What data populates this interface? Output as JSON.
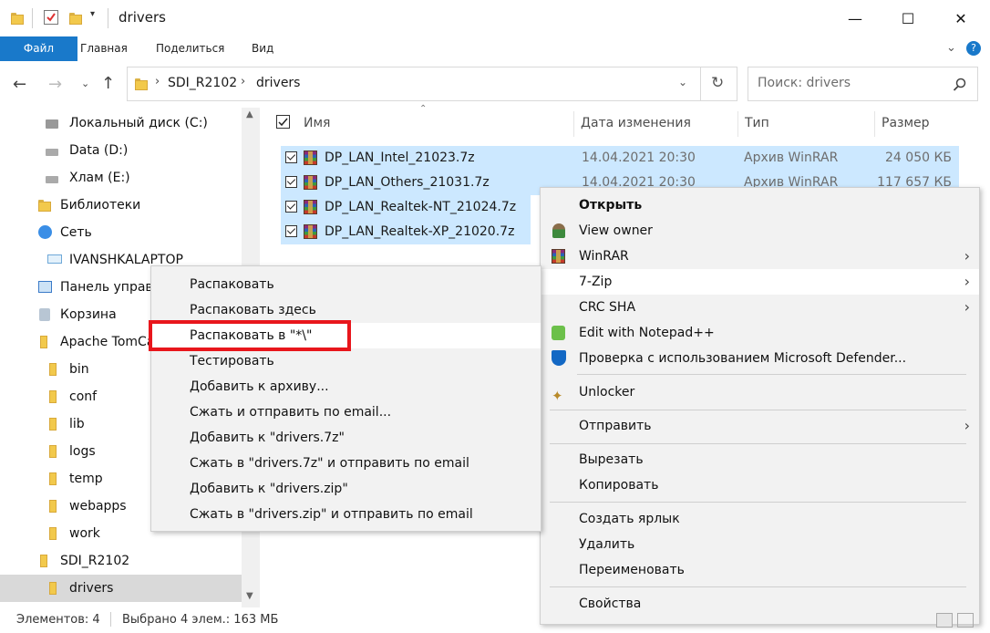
{
  "window": {
    "title": "drivers",
    "minimize": "—",
    "maximize": "☐",
    "close": "✕"
  },
  "ribbon": {
    "tabs": [
      "Файл",
      "Главная",
      "Поделиться",
      "Вид"
    ]
  },
  "address": {
    "crumbs": [
      "SDI_R2102",
      "drivers"
    ]
  },
  "search": {
    "placeholder": "Поиск: drivers"
  },
  "nav": {
    "items": [
      "Локальный диск (C:)",
      "Data (D:)",
      "Хлам (E:)",
      "Библиотеки",
      "Сеть",
      "IVANSHKALAPTOP",
      "Панель управл",
      "Корзина",
      "Apache TomCa",
      "bin",
      "conf",
      "lib",
      "logs",
      "temp",
      "webapps",
      "work",
      "SDI_R2102",
      "drivers"
    ]
  },
  "columns": {
    "name": "Имя",
    "date": "Дата изменения",
    "type": "Тип",
    "size": "Размер"
  },
  "files": [
    {
      "name": "DP_LAN_Intel_21023.7z",
      "date": "14.04.2021 20:30",
      "type": "Архив WinRAR",
      "size": "24 050 КБ"
    },
    {
      "name": "DP_LAN_Others_21031.7z",
      "date": "14.04.2021 20:30",
      "type": "Архив WinRAR",
      "size": "117 657 КБ"
    },
    {
      "name": "DP_LAN_Realtek-NT_21024.7z",
      "date": "",
      "type": "",
      "size": ""
    },
    {
      "name": "DP_LAN_Realtek-XP_21020.7z",
      "date": "",
      "type": "",
      "size": ""
    }
  ],
  "context_menu": {
    "open": "Открыть",
    "view_owner": "View owner",
    "winrar": "WinRAR",
    "sevenzip": "7-Zip",
    "crc": "CRC SHA",
    "notepad": "Edit with Notepad++",
    "defender": "Проверка с использованием Microsoft Defender...",
    "unlocker": "Unlocker",
    "send_to": "Отправить",
    "cut": "Вырезать",
    "copy": "Копировать",
    "shortcut": "Создать ярлык",
    "delete": "Удалить",
    "rename": "Переименовать",
    "properties": "Свойства"
  },
  "sevenzip_menu": [
    "Распаковать",
    "Распаковать здесь",
    "Распаковать в \"*\\\"",
    "Тестировать",
    "Добавить к архиву...",
    "Сжать и отправить по email...",
    "Добавить к \"drivers.7z\"",
    "Сжать в \"drivers.7z\" и отправить по email",
    "Добавить к \"drivers.zip\"",
    "Сжать в \"drivers.zip\" и отправить по email"
  ],
  "status": {
    "count": "Элементов: 4",
    "selected": "Выбрано 4 элем.: 163 МБ"
  },
  "colors": {
    "accent": "#1979ca",
    "selection": "#cce8ff",
    "highlight_box": "#e8161c"
  }
}
